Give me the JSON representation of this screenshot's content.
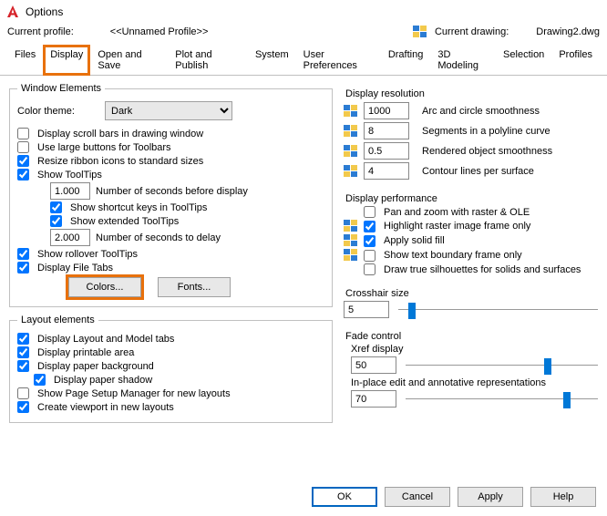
{
  "window": {
    "title": "Options"
  },
  "profile": {
    "label": "Current profile:",
    "value": "<<Unnamed Profile>>",
    "drawing_label": "Current drawing:",
    "drawing_value": "Drawing2.dwg"
  },
  "tabs": {
    "files": "Files",
    "display": "Display",
    "open_save": "Open and Save",
    "plot": "Plot and Publish",
    "system": "System",
    "user": "User Preferences",
    "drafting": "Drafting",
    "modeling": "3D Modeling",
    "selection": "Selection",
    "profiles": "Profiles"
  },
  "window_elements": {
    "legend": "Window Elements",
    "color_theme_label": "Color theme:",
    "color_theme_value": "Dark",
    "scroll_bars": "Display scroll bars in drawing window",
    "large_buttons": "Use large buttons for Toolbars",
    "resize_ribbon": "Resize ribbon icons to standard sizes",
    "show_tooltips": "Show ToolTips",
    "tooltip_seconds_value": "1.000",
    "tooltip_seconds_label": "Number of seconds before display",
    "shortcut_keys": "Show shortcut keys in ToolTips",
    "extended_tooltips": "Show extended ToolTips",
    "delay_seconds_value": "2.000",
    "delay_seconds_label": "Number of seconds to delay",
    "rollover": "Show rollover ToolTips",
    "file_tabs": "Display File Tabs",
    "colors_btn": "Colors...",
    "fonts_btn": "Fonts..."
  },
  "layout_elements": {
    "legend": "Layout elements",
    "layout_model_tabs": "Display Layout and Model tabs",
    "printable_area": "Display printable area",
    "paper_background": "Display paper background",
    "paper_shadow": "Display paper shadow",
    "page_setup": "Show Page Setup Manager for new layouts",
    "create_viewport": "Create viewport in new layouts"
  },
  "display_resolution": {
    "legend": "Display resolution",
    "arc_value": "1000",
    "arc_label": "Arc and circle smoothness",
    "seg_value": "8",
    "seg_label": "Segments in a polyline curve",
    "render_value": "0.5",
    "render_label": "Rendered object smoothness",
    "contour_value": "4",
    "contour_label": "Contour lines per surface"
  },
  "display_performance": {
    "legend": "Display performance",
    "pan_zoom": "Pan and zoom with raster & OLE",
    "highlight_raster": "Highlight raster image frame only",
    "solid_fill": "Apply solid fill",
    "text_boundary": "Show text boundary frame only",
    "silhouettes": "Draw true silhouettes for solids and surfaces"
  },
  "crosshair": {
    "label": "Crosshair size",
    "value": "5"
  },
  "fade": {
    "legend": "Fade control",
    "xref_label": "Xref display",
    "xref_value": "50",
    "inplace_label": "In-place edit and annotative representations",
    "inplace_value": "70"
  },
  "buttons": {
    "ok": "OK",
    "cancel": "Cancel",
    "apply": "Apply",
    "help": "Help"
  }
}
